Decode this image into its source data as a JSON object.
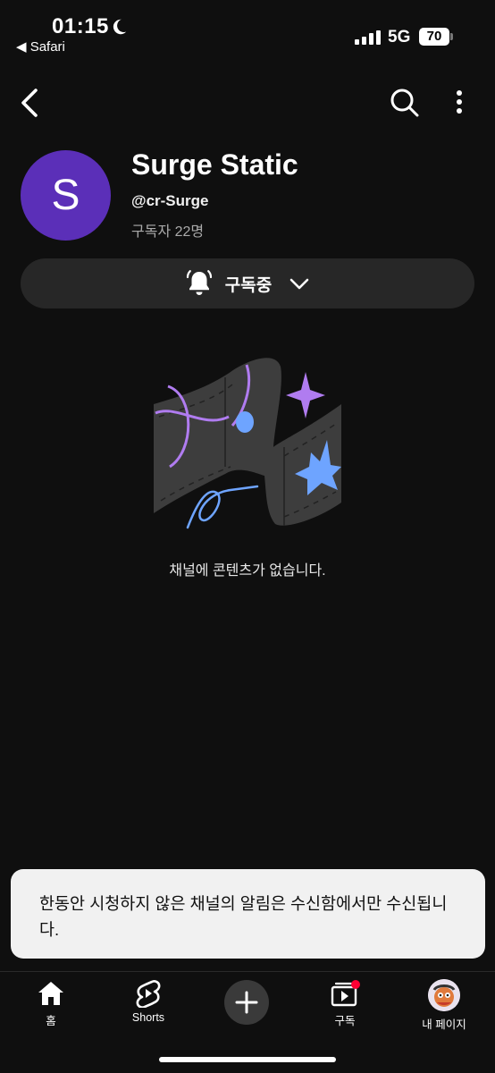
{
  "status_bar": {
    "time": "01:15",
    "back_app": "◀ Safari",
    "network": "5G",
    "battery": "70"
  },
  "channel": {
    "avatar_letter": "S",
    "name": "Surge Static",
    "handle": "@cr-Surge",
    "subscribers": "구독자 22명",
    "avatar_color": "#5b2fb8"
  },
  "subscribe_button": {
    "label": "구독중"
  },
  "empty_state": {
    "message": "채널에 콘텐츠가 없습니다."
  },
  "toast": {
    "message": "한동안 시청하지 않은 채널의 알림은 수신함에서만 수신됩니다."
  },
  "bottom_nav": {
    "items": [
      {
        "label": "홈",
        "icon": "home-icon"
      },
      {
        "label": "Shorts",
        "icon": "shorts-icon"
      },
      {
        "label": "",
        "icon": "plus-icon"
      },
      {
        "label": "구독",
        "icon": "subscriptions-icon"
      },
      {
        "label": "내 페이지",
        "icon": "profile-avatar"
      }
    ]
  },
  "colors": {
    "background": "#0f0f0f",
    "button": "#272727",
    "toast": "#f1f1f1",
    "notification_dot": "#ff0033"
  }
}
